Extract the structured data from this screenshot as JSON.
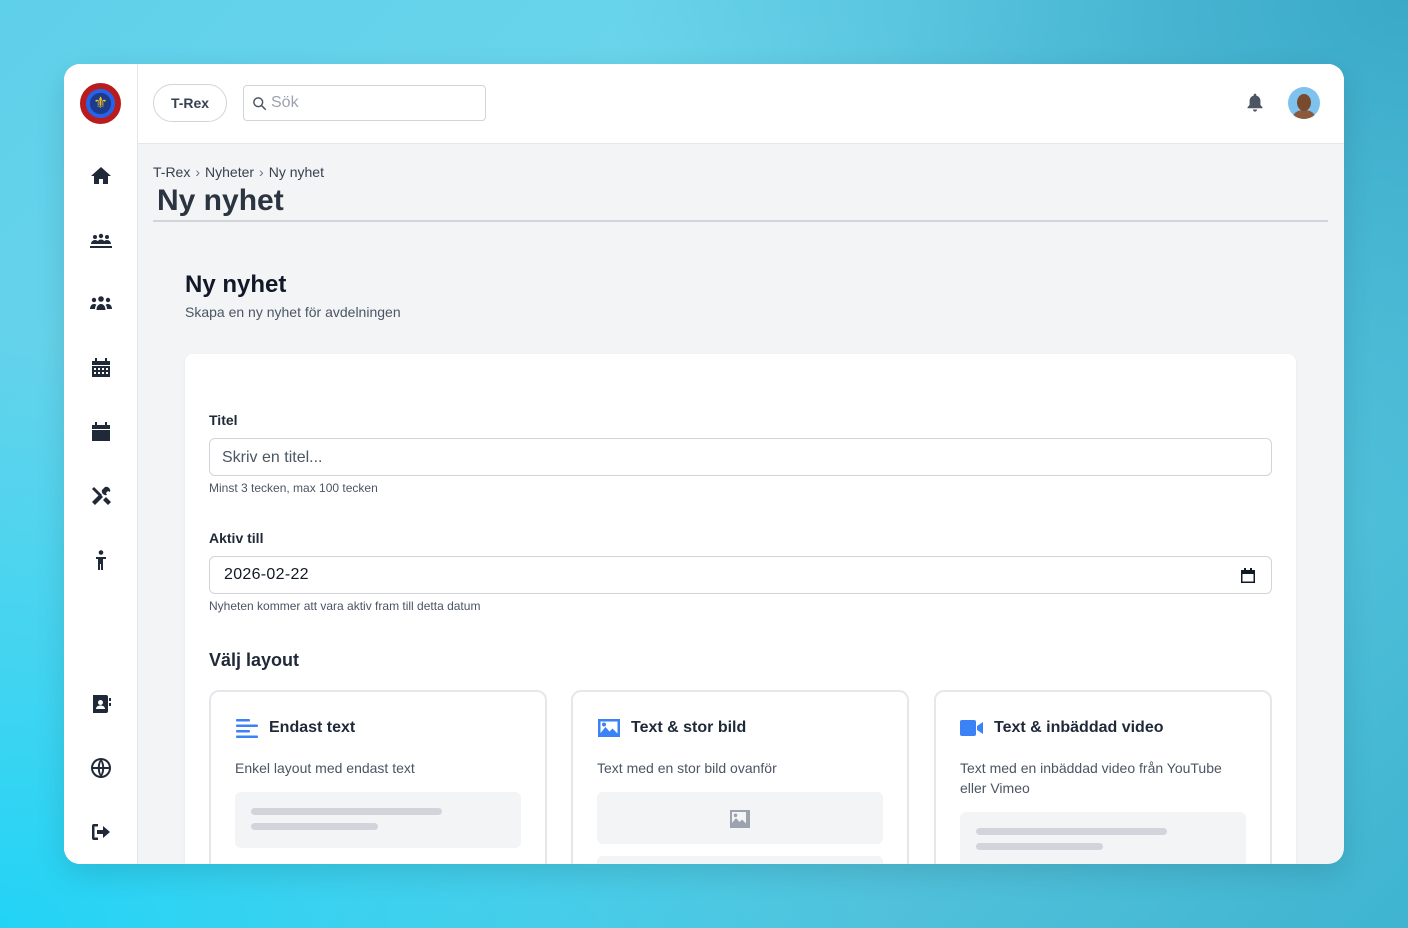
{
  "sidebar": {
    "logo_symbol": "⚜",
    "items": [
      {
        "name": "home-icon"
      },
      {
        "name": "troop-icon"
      },
      {
        "name": "members-icon"
      },
      {
        "name": "calendar-grid-icon"
      },
      {
        "name": "calendar-icon"
      },
      {
        "name": "tools-icon"
      },
      {
        "name": "child-icon"
      },
      {
        "name": "contacts-icon"
      },
      {
        "name": "globe-icon"
      },
      {
        "name": "logout-icon"
      }
    ]
  },
  "topbar": {
    "org_label": "T-Rex",
    "search_placeholder": "Sök"
  },
  "breadcrumb": [
    "T-Rex",
    "Nyheter",
    "Ny nyhet"
  ],
  "breadcrumb_sep": "›",
  "page_title": "Ny nyhet",
  "section": {
    "title": "Ny nyhet",
    "subtitle": "Skapa en ny nyhet för avdelningen"
  },
  "form": {
    "title_label": "Titel",
    "title_placeholder": "Skriv en titel...",
    "title_hint": "Minst 3 tecken, max 100 tecken",
    "active_label": "Aktiv till",
    "active_value": "2026-02-22",
    "active_hint": "Nyheten kommer att vara aktiv fram till detta datum",
    "layout_heading": "Välj layout"
  },
  "layouts": [
    {
      "title": "Endast text",
      "description": "Enkel layout med endast text",
      "icon": "text-lines-icon"
    },
    {
      "title": "Text & stor bild",
      "description": "Text med en stor bild ovanför",
      "icon": "image-icon"
    },
    {
      "title": "Text & inbäddad video",
      "description": "Text med en inbäddad video från YouTube eller Vimeo",
      "icon": "video-icon"
    }
  ],
  "colors": {
    "accent": "#3b82f6",
    "text": "#1f2937",
    "muted": "#4b5563",
    "background": "#f3f4f6"
  }
}
